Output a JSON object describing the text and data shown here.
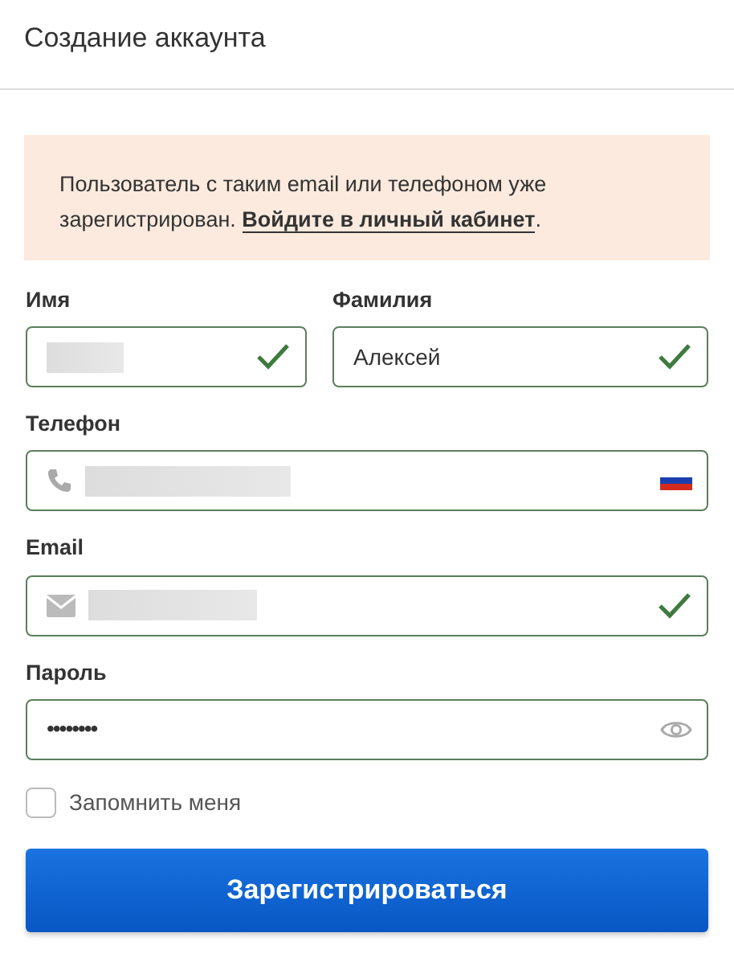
{
  "header": {
    "title": "Создание аккаунта"
  },
  "alert": {
    "text": "Пользователь с таким email или телефоном уже зарегистрирован. ",
    "link": "Войдите в личный кабинет",
    "suffix": "."
  },
  "name_row": [
    {
      "label": "Имя",
      "redacted": true,
      "valid": true
    },
    {
      "label": "Фамилия",
      "value": "Алексей",
      "valid": true
    }
  ],
  "fields": [
    {
      "label": "Телефон",
      "kind": "phone",
      "redacted": true,
      "valid": false
    },
    {
      "label": "Email",
      "kind": "email",
      "redacted": true,
      "valid": true
    },
    {
      "label": "Пароль",
      "kind": "password",
      "value": "••••••••",
      "valid": false
    }
  ],
  "remember": {
    "label": "Запомнить меня",
    "checked": false
  },
  "submit": {
    "label": "Зарегистрироваться"
  }
}
